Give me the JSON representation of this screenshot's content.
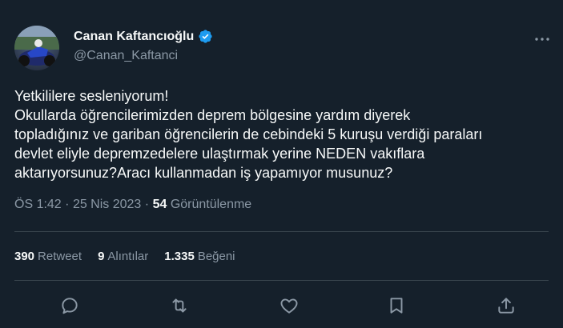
{
  "author": {
    "display_name": "Canan Kaftancıoğlu",
    "handle": "@Canan_Kaftanci",
    "verified": true
  },
  "tweet": {
    "text": "Yetkililere sesleniyorum!\nOkullarda öğrencilerimizden deprem bölgesine yardım diyerek\ntopladığınız ve gariban öğrencilerin de cebindeki 5 kuruşu verdiği paraları\ndevlet eliyle depremzedelere ulaştırmak yerine NEDEN vakıflara\naktarıyorsunuz?Aracı kullanmadan iş yapamıyor musunuz?",
    "time": "ÖS 1:42",
    "separator": "·",
    "date": "25 Nis 2023",
    "views_count": "54",
    "views_label": "Görüntülenme"
  },
  "stats": {
    "retweets": "390",
    "retweets_label": "Retweet",
    "quotes": "9",
    "quotes_label": "Alıntılar",
    "likes": "1.335",
    "likes_label": "Beğeni"
  },
  "colors": {
    "background": "#15202b",
    "text": "#f7f9f9",
    "secondary": "#8b98a5",
    "divider": "#38444d",
    "verified": "#1d9bf0"
  },
  "icons": [
    "more-icon",
    "verified-icon",
    "reply-icon",
    "retweet-icon",
    "like-icon",
    "bookmark-icon",
    "share-icon"
  ]
}
